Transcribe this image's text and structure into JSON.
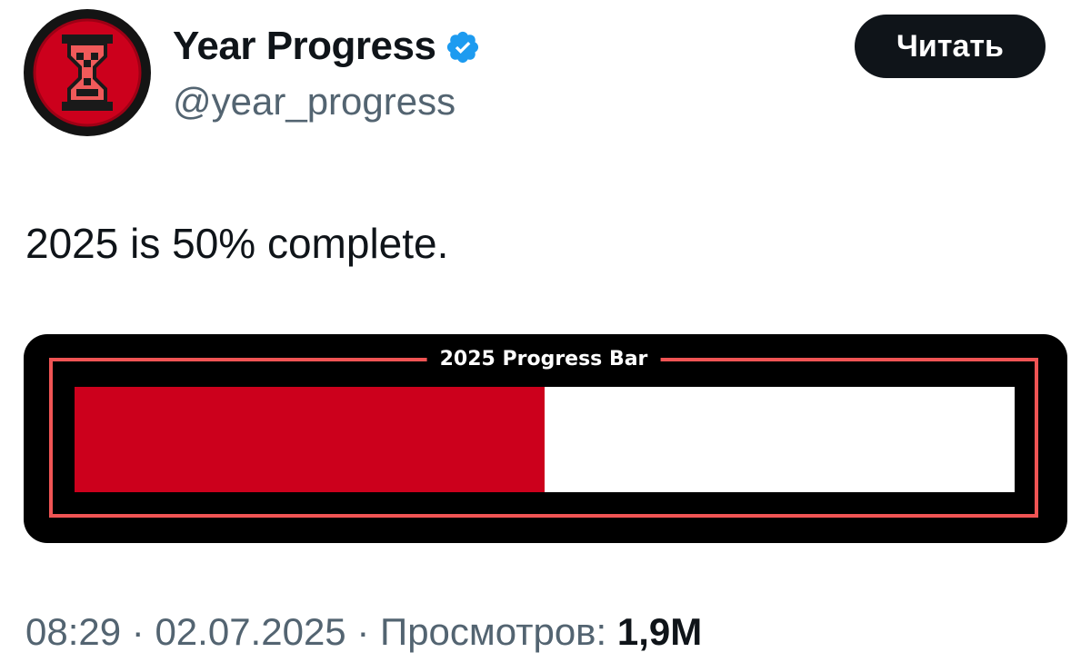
{
  "author": {
    "display_name": "Year Progress",
    "handle": "@year_progress",
    "verified": true,
    "avatar_icon": "hourglass-icon",
    "avatar_colors": {
      "ring": "#cc001c",
      "bg": "#141414",
      "glyph": "#f05a5a"
    }
  },
  "follow_button": {
    "label": "Читать"
  },
  "tweet": {
    "text": "2025 is 50% complete."
  },
  "media": {
    "title": "2025 Progress Bar",
    "progress_fraction": 0.5,
    "fill_color": "#cc001c",
    "frame_color": "#f05454"
  },
  "meta": {
    "time": "08:29",
    "separator": "·",
    "date": "02.07.2025",
    "views_label": "Просмотров:",
    "views_count": "1,9M"
  }
}
